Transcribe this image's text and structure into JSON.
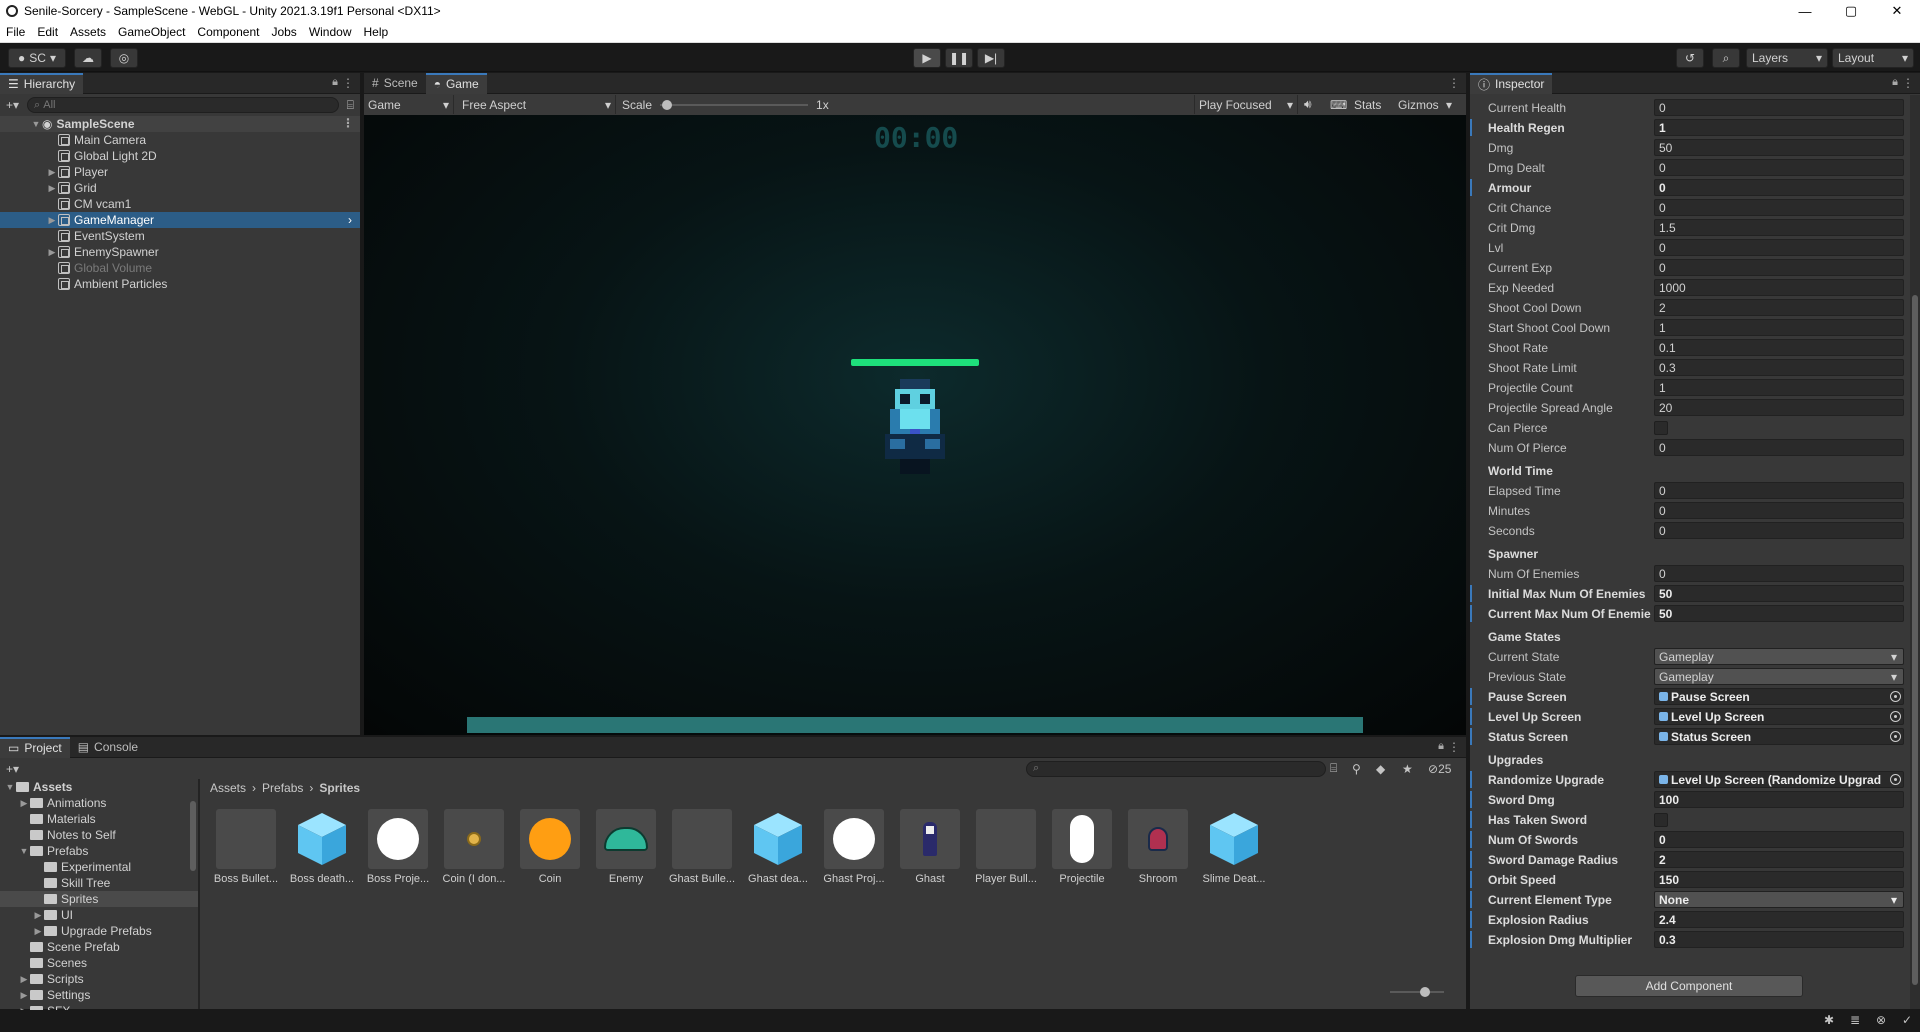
{
  "window": {
    "title": "Senile-Sorcery - SampleScene - WebGL - Unity 2021.3.19f1 Personal <DX11>",
    "minimize": "—",
    "maximize": "▢",
    "close": "✕"
  },
  "menu": [
    "File",
    "Edit",
    "Assets",
    "GameObject",
    "Component",
    "Jobs",
    "Window",
    "Help"
  ],
  "toolbar": {
    "account": "SC",
    "layers": "Layers",
    "layout": "Layout"
  },
  "hierarchy": {
    "tab": "Hierarchy",
    "search_placeholder": "All",
    "scene": "SampleScene",
    "items": [
      {
        "label": "Main Camera",
        "expand": false,
        "state": ""
      },
      {
        "label": "Global Light 2D",
        "expand": false,
        "state": ""
      },
      {
        "label": "Player",
        "expand": true,
        "state": ""
      },
      {
        "label": "Grid",
        "expand": true,
        "state": ""
      },
      {
        "label": "CM vcam1",
        "expand": false,
        "state": ""
      },
      {
        "label": "GameManager",
        "expand": true,
        "state": "selected"
      },
      {
        "label": "EventSystem",
        "expand": false,
        "state": ""
      },
      {
        "label": "EnemySpawner",
        "expand": true,
        "state": ""
      },
      {
        "label": "Global Volume",
        "expand": false,
        "state": "disabled"
      },
      {
        "label": "Ambient Particles",
        "expand": false,
        "state": ""
      }
    ]
  },
  "scene_tabs": {
    "scene": "Scene",
    "game": "Game"
  },
  "gamebar": {
    "display": "Game",
    "aspect": "Free Aspect",
    "scale_label": "Scale",
    "scale_value": "1x",
    "play_mode": "Play Focused",
    "stats": "Stats",
    "gizmos": "Gizmos"
  },
  "game": {
    "timer": "00:00"
  },
  "inspector": {
    "tab": "Inspector",
    "rows": [
      {
        "label": "Current Health",
        "value": "0",
        "type": "field",
        "bold": false
      },
      {
        "label": "Health Regen",
        "value": "1",
        "type": "field",
        "bold": true
      },
      {
        "label": "Dmg",
        "value": "50",
        "type": "field",
        "bold": false
      },
      {
        "label": "Dmg Dealt",
        "value": "0",
        "type": "field",
        "bold": false
      },
      {
        "label": "Armour",
        "value": "0",
        "type": "field",
        "bold": true
      },
      {
        "label": "Crit Chance",
        "value": "0",
        "type": "field",
        "bold": false
      },
      {
        "label": "Crit Dmg",
        "value": "1.5",
        "type": "field",
        "bold": false
      },
      {
        "label": "Lvl",
        "value": "0",
        "type": "field",
        "bold": false
      },
      {
        "label": "Current Exp",
        "value": "0",
        "type": "field",
        "bold": false
      },
      {
        "label": "Exp Needed",
        "value": "1000",
        "type": "field",
        "bold": false
      },
      {
        "label": "Shoot Cool Down",
        "value": "2",
        "type": "field",
        "bold": false
      },
      {
        "label": "Start Shoot Cool Down",
        "value": "1",
        "type": "field",
        "bold": false
      },
      {
        "label": "Shoot Rate",
        "value": "0.1",
        "type": "field",
        "bold": false
      },
      {
        "label": "Shoot Rate Limit",
        "value": "0.3",
        "type": "field",
        "bold": false
      },
      {
        "label": "Projectile Count",
        "value": "1",
        "type": "field",
        "bold": false
      },
      {
        "label": "Projectile Spread Angle",
        "value": "20",
        "type": "field",
        "bold": false
      },
      {
        "label": "Can Pierce",
        "value": "",
        "type": "check",
        "bold": false
      },
      {
        "label": "Num Of Pierce",
        "value": "0",
        "type": "field",
        "bold": false
      },
      {
        "label": "World Time",
        "value": "",
        "type": "section",
        "bold": true
      },
      {
        "label": "Elapsed Time",
        "value": "0",
        "type": "field",
        "bold": false
      },
      {
        "label": "Minutes",
        "value": "0",
        "type": "field",
        "bold": false
      },
      {
        "label": "Seconds",
        "value": "0",
        "type": "field",
        "bold": false
      },
      {
        "label": "Spawner",
        "value": "",
        "type": "section",
        "bold": true
      },
      {
        "label": "Num Of Enemies",
        "value": "0",
        "type": "field",
        "bold": false
      },
      {
        "label": "Initial Max Num Of Enemies",
        "value": "50",
        "type": "field",
        "bold": true
      },
      {
        "label": "Current Max Num Of Enemie",
        "value": "50",
        "type": "field",
        "bold": true
      },
      {
        "label": "Game States",
        "value": "",
        "type": "section",
        "bold": true
      },
      {
        "label": "Current State",
        "value": "Gameplay",
        "type": "drop",
        "bold": false
      },
      {
        "label": "Previous State",
        "value": "Gameplay",
        "type": "drop",
        "bold": false
      },
      {
        "label": "Pause Screen",
        "value": "Pause Screen",
        "type": "obj",
        "bold": true
      },
      {
        "label": "Level Up Screen",
        "value": "Level Up Screen",
        "type": "obj",
        "bold": true
      },
      {
        "label": "Status Screen",
        "value": "Status Screen",
        "type": "obj",
        "bold": true
      },
      {
        "label": "Upgrades",
        "value": "",
        "type": "section",
        "bold": true
      },
      {
        "label": "Randomize Upgrade",
        "value": "Level Up Screen (Randomize Upgrad",
        "type": "obj",
        "bold": true
      },
      {
        "label": "Sword Dmg",
        "value": "100",
        "type": "field",
        "bold": true
      },
      {
        "label": "Has Taken Sword",
        "value": "",
        "type": "check",
        "bold": true
      },
      {
        "label": "Num Of Swords",
        "value": "0",
        "type": "field",
        "bold": true
      },
      {
        "label": "Sword Damage Radius",
        "value": "2",
        "type": "field",
        "bold": true
      },
      {
        "label": "Orbit Speed",
        "value": "150",
        "type": "field",
        "bold": true
      },
      {
        "label": "Current Element Type",
        "value": "None",
        "type": "drop",
        "bold": true
      },
      {
        "label": "Explosion Radius",
        "value": "2.4",
        "type": "field",
        "bold": true
      },
      {
        "label": "Explosion Dmg Multiplier",
        "value": "0.3",
        "type": "field",
        "bold": true
      }
    ],
    "add_component": "Add Component"
  },
  "project": {
    "tab_project": "Project",
    "tab_console": "Console",
    "hidden_count": "25",
    "breadcrumb": [
      "Assets",
      "Prefabs",
      "Sprites"
    ],
    "tree": [
      {
        "label": "Assets",
        "depth": 0,
        "expand": "down",
        "sel": false
      },
      {
        "label": "Animations",
        "depth": 1,
        "expand": "right",
        "sel": false
      },
      {
        "label": "Materials",
        "depth": 1,
        "expand": "",
        "sel": false
      },
      {
        "label": "Notes to Self",
        "depth": 1,
        "expand": "",
        "sel": false
      },
      {
        "label": "Prefabs",
        "depth": 1,
        "expand": "down",
        "sel": false
      },
      {
        "label": "Experimental",
        "depth": 2,
        "expand": "",
        "sel": false
      },
      {
        "label": "Skill Tree",
        "depth": 2,
        "expand": "",
        "sel": false
      },
      {
        "label": "Sprites",
        "depth": 2,
        "expand": "",
        "sel": true
      },
      {
        "label": "UI",
        "depth": 2,
        "expand": "right",
        "sel": false
      },
      {
        "label": "Upgrade Prefabs",
        "depth": 2,
        "expand": "right",
        "sel": false
      },
      {
        "label": "Scene Prefab",
        "depth": 1,
        "expand": "",
        "sel": false
      },
      {
        "label": "Scenes",
        "depth": 1,
        "expand": "",
        "sel": false
      },
      {
        "label": "Scripts",
        "depth": 1,
        "expand": "right",
        "sel": false
      },
      {
        "label": "Settings",
        "depth": 1,
        "expand": "right",
        "sel": false
      },
      {
        "label": "SFX",
        "depth": 1,
        "expand": "right",
        "sel": false
      }
    ],
    "assets": [
      {
        "name": "Boss Bullet...",
        "kind": "blank"
      },
      {
        "name": "Boss death...",
        "kind": "cube"
      },
      {
        "name": "Boss Proje...",
        "kind": "white"
      },
      {
        "name": "Coin (I don...",
        "kind": "smallcoin"
      },
      {
        "name": "Coin",
        "kind": "coin"
      },
      {
        "name": "Enemy",
        "kind": "enemy"
      },
      {
        "name": "Ghast Bulle...",
        "kind": "blank"
      },
      {
        "name": "Ghast dea...",
        "kind": "cube"
      },
      {
        "name": "Ghast Proj...",
        "kind": "white"
      },
      {
        "name": "Ghast",
        "kind": "ghast"
      },
      {
        "name": "Player Bull...",
        "kind": "blank"
      },
      {
        "name": "Projectile",
        "kind": "capsule"
      },
      {
        "name": "Shroom",
        "kind": "shroom"
      },
      {
        "name": "Slime Deat...",
        "kind": "cube"
      }
    ]
  }
}
